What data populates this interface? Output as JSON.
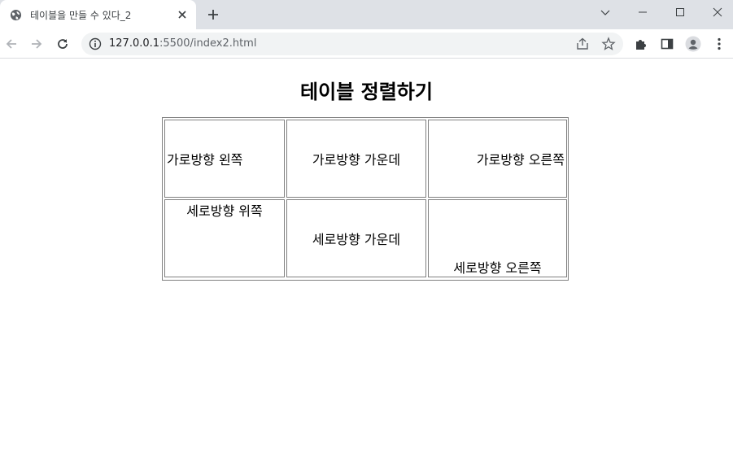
{
  "browser": {
    "tab": {
      "title": "테이블을 만들 수 있다_2",
      "favicon": "globe-icon"
    },
    "new_tab_icon": "plus-icon",
    "window_controls": [
      "chevron-down-icon",
      "minimize-icon",
      "maximize-icon",
      "close-icon"
    ],
    "url": {
      "host": "127.0.0.1",
      "rest": ":5500/index2.html"
    }
  },
  "page": {
    "heading": "테이블 정렬하기",
    "rows": [
      [
        {
          "text": "가로방향 왼쪽"
        },
        {
          "text": "가로방향 가운데"
        },
        {
          "text": "가로방향 오른쪽"
        }
      ],
      [
        {
          "text": "세로방향 위쪽"
        },
        {
          "text": "세로방향 가운데"
        },
        {
          "text": "세로방향 오른쪽"
        }
      ]
    ]
  }
}
